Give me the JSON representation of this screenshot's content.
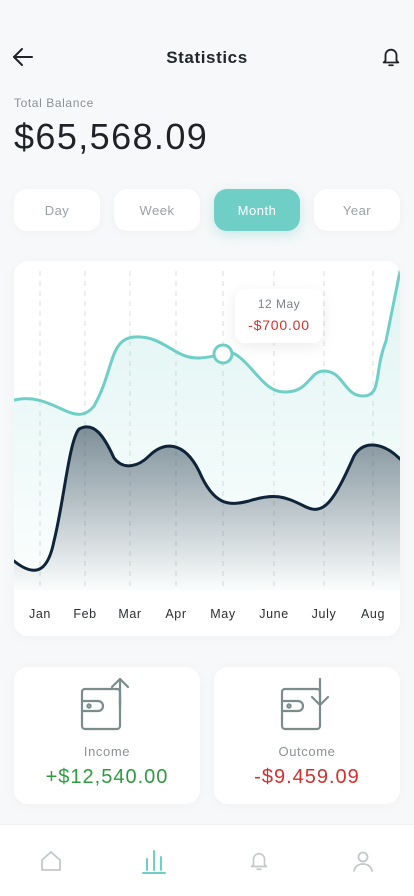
{
  "header": {
    "title": "Statistics",
    "back_icon": "arrow-left-icon",
    "bell_icon": "bell-icon"
  },
  "balance": {
    "label": "Total Balance",
    "amount": "$65,568.09"
  },
  "tabs": [
    {
      "label": "Day",
      "active": false
    },
    {
      "label": "Week",
      "active": false
    },
    {
      "label": "Month",
      "active": true
    },
    {
      "label": "Year",
      "active": false
    }
  ],
  "tooltip": {
    "date": "12 May",
    "amount": "-$700.00"
  },
  "chart_data": {
    "type": "area",
    "categories": [
      "Jan",
      "Feb",
      "Mar",
      "Apr",
      "May",
      "June",
      "July",
      "Aug"
    ],
    "xlabel": "",
    "ylabel": "",
    "grid": "vertical-dashed",
    "legend": "none",
    "series": [
      {
        "color": "#6fcfc7",
        "values": [
          0.62,
          0.52,
          0.9,
          0.83,
          0.8,
          0.68,
          0.78,
          0.62
        ]
      },
      {
        "color": "#0f2438",
        "values": [
          0.06,
          0.6,
          0.52,
          0.5,
          0.3,
          0.32,
          0.24,
          0.52
        ]
      }
    ],
    "highlight": {
      "series": 0,
      "category": "May",
      "label_date": "12 May",
      "label_value": "-$700.00"
    }
  },
  "income": {
    "label": "Income",
    "value": "+$12,540.00",
    "icon": "wallet-arrow-up-icon"
  },
  "outcome": {
    "label": "Outcome",
    "value": "-$9.459.09",
    "icon": "wallet-arrow-down-icon"
  },
  "nav": [
    {
      "icon": "home-icon",
      "active": false
    },
    {
      "icon": "bar-chart-icon",
      "active": true
    },
    {
      "icon": "bell-icon",
      "active": false
    },
    {
      "icon": "user-icon",
      "active": false
    }
  ],
  "colors": {
    "accent": "#6fcfc7",
    "dark_series": "#0f2438",
    "positive": "#2e9b3f",
    "negative": "#d0312d"
  }
}
